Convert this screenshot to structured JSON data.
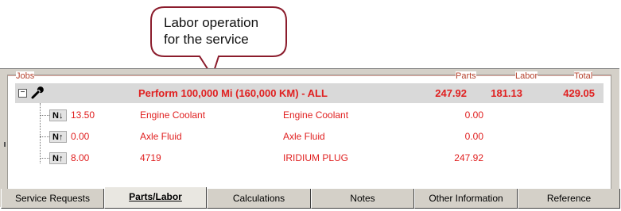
{
  "callout": {
    "line1": "Labor operation",
    "line2": "for the service"
  },
  "columns": {
    "jobs": "Jobs",
    "parts": "Parts",
    "labor": "Labor",
    "total": "Total"
  },
  "job": {
    "expander": "−",
    "title": "Perform 100,000 Mi (160,000 KM) - ALL",
    "parts": "247.92",
    "labor": "181.13",
    "total": "429.05",
    "icon": "wrench-icon"
  },
  "lines": [
    {
      "badge": "N↓",
      "qty": "13.50",
      "name": "Engine Coolant",
      "description": "Engine Coolant",
      "amount": "0.00"
    },
    {
      "badge": "N↑",
      "qty": "0.00",
      "name": "Axle Fluid",
      "description": "Axle Fluid",
      "amount": "0.00"
    },
    {
      "badge": "N↑",
      "qty": "8.00",
      "name": "4719",
      "description": "IRIDIUM PLUG",
      "amount": "247.92"
    }
  ],
  "tabs": [
    {
      "label": "Service Requests",
      "active": false
    },
    {
      "label": "Parts/Labor",
      "active": true
    },
    {
      "label": "Calculations",
      "active": false
    },
    {
      "label": "Notes",
      "active": false
    },
    {
      "label": "Other Information",
      "active": false
    },
    {
      "label": "Reference",
      "active": false
    }
  ],
  "colors": {
    "accent_red": "#e02020",
    "header_label": "#b5412c",
    "panel_bg": "#d4d0c8",
    "job_row_bg": "#d9d9d9",
    "callout_border": "#8b1c2c"
  }
}
